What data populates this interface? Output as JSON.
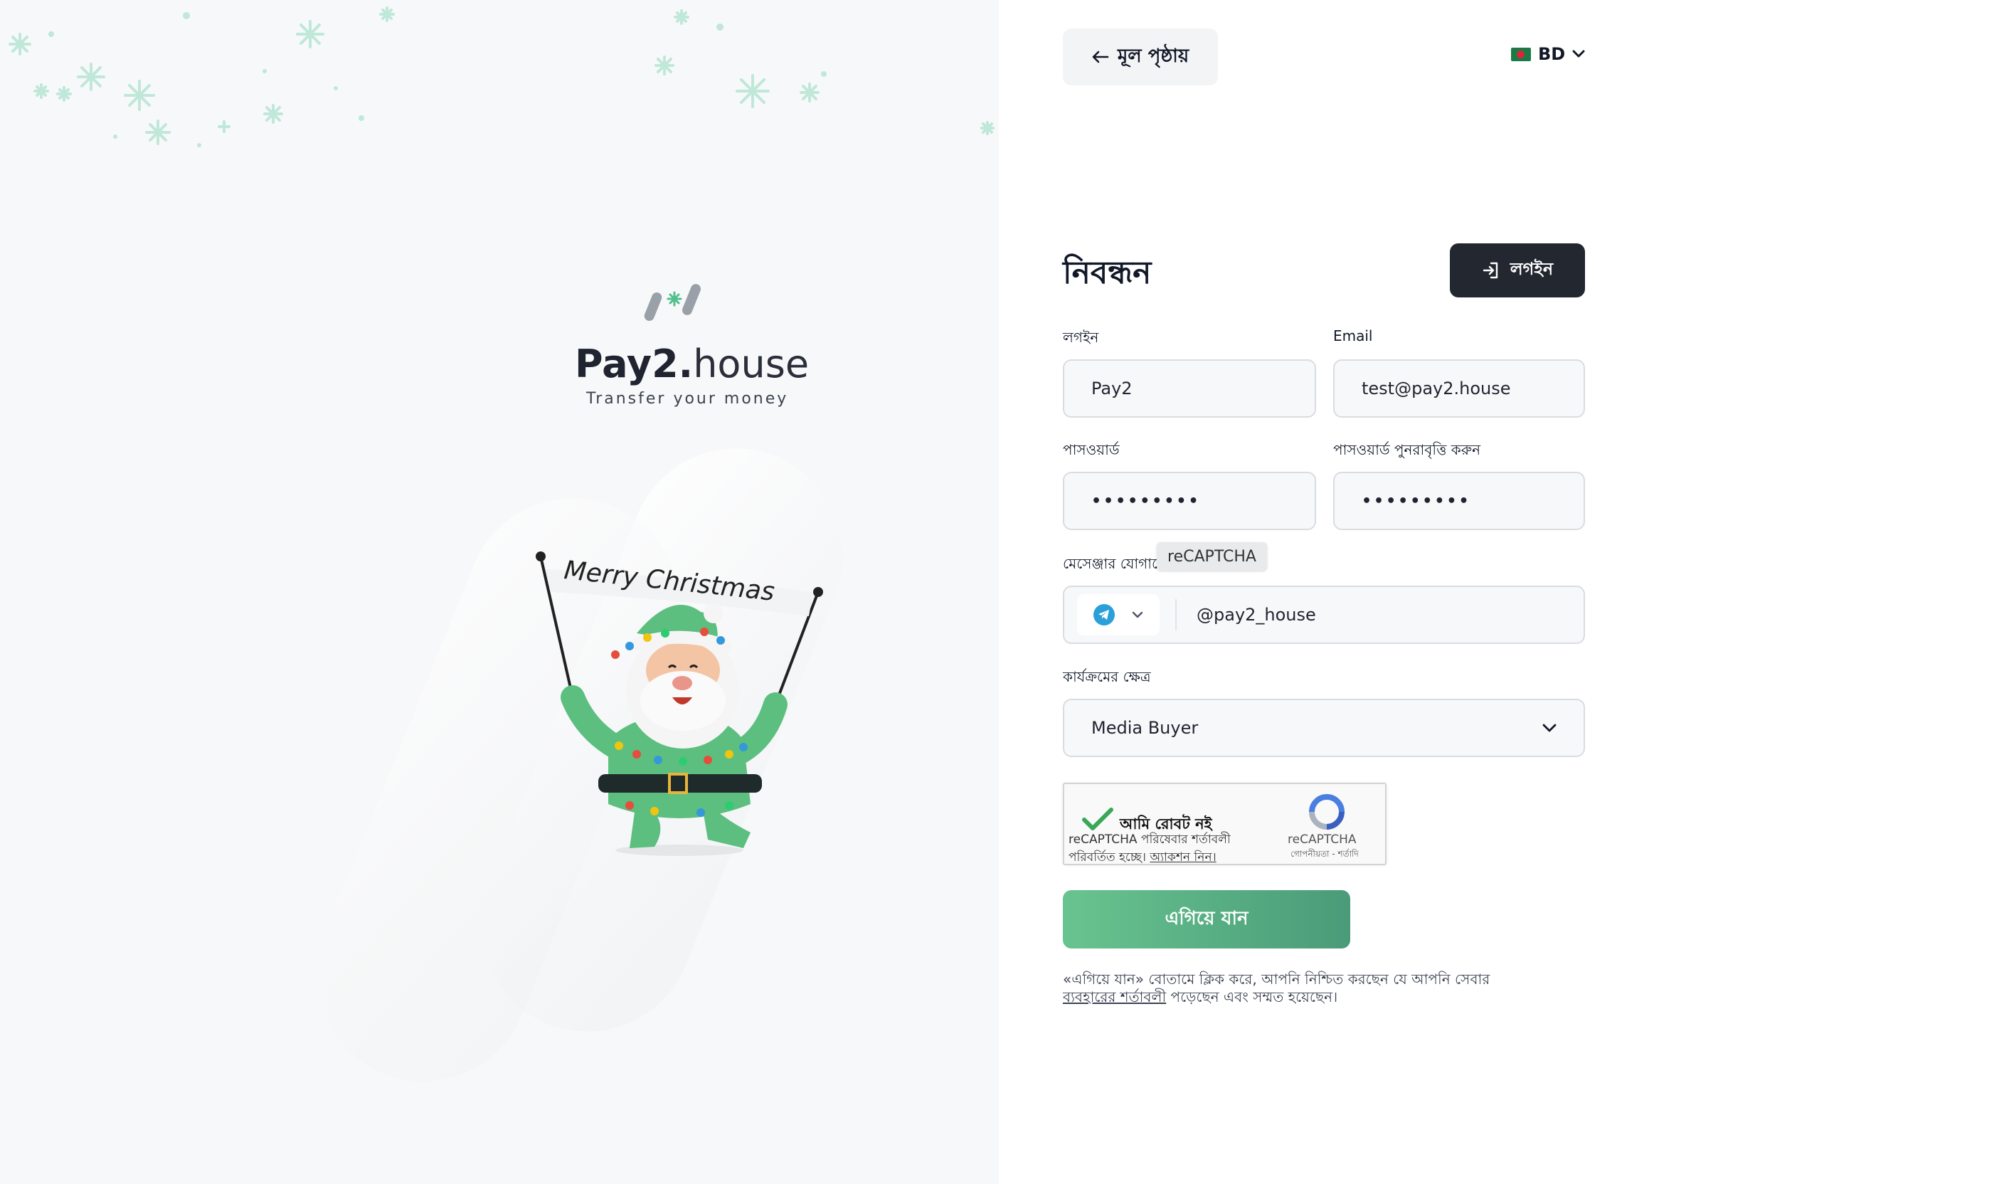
{
  "brand": {
    "name_bold": "Pay2.",
    "name_light": "house",
    "tagline": "Transfer your money",
    "banner_text": "Merry Christmas"
  },
  "nav": {
    "home_label": "মূল পৃষ্ঠায়",
    "language_code": "BD"
  },
  "form": {
    "title": "নিবন্ধন",
    "login_button": "লগইন",
    "login_label": "লগইন",
    "login_value": "Pay2",
    "email_label": "Email",
    "email_value": "test@pay2.house",
    "password_label": "পাসওয়ার্ড",
    "password_value": "•••••••••",
    "password_repeat_label": "পাসওয়ার্ড পুনরাবৃত্তি করুন",
    "password_repeat_value": "•••••••••",
    "messenger_label": "মেসেঞ্জার যোগাযোগ",
    "messenger_tooltip": "reCAPTCHA",
    "messenger_value": "@pay2_house",
    "activity_label": "কার্যক্রমের ক্ষেত্র",
    "activity_value": "Media Buyer",
    "submit_label": "এগিয়ে যান",
    "terms_text": "«এগিয়ে যান» বোতামে ক্লিক করে, আপনি নিশ্চিত করছেন যে আপনি সেবার",
    "terms_link": "ব্যবহারের শর্তাবলী",
    "terms_suffix": " পড়েছেন এবং সম্মত হয়েছেন।"
  },
  "captcha": {
    "label": "আমি রোবট নই",
    "terms_line1": "reCAPTCHA পরিষেবার শর্তাবলী",
    "terms_line2_prefix": "পরিবর্তিত হচ্ছে। ",
    "terms_link": "অ্যাকশন নিন।",
    "brand": "reCAPTCHA",
    "links": "গোপনীয়তা - শর্তাদি"
  },
  "colors": {
    "accent_green": "#68c48f",
    "accent_green_dark": "#4a9b79",
    "dark_button": "#222730",
    "telegram": "#2a9fd8",
    "snowflake": "#bfe8d9"
  },
  "icons": {
    "back": "arrow-left-icon",
    "language_dropdown": "chevron-down-icon",
    "login": "login-enter-icon",
    "messenger": "telegram-icon",
    "select_dropdown": "chevron-down-icon",
    "captcha": "recaptcha-logo-icon"
  }
}
